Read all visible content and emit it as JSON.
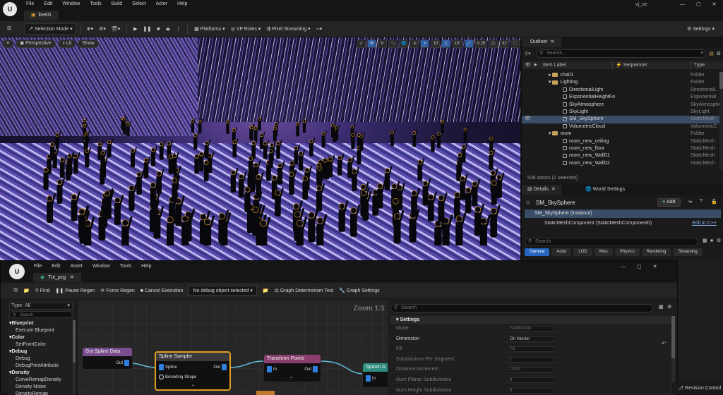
{
  "window": {
    "menu": [
      "File",
      "Edit",
      "Window",
      "Tools",
      "Build",
      "Select",
      "Actor",
      "Help"
    ],
    "tab": "live01",
    "user": "vj_ue",
    "controls": [
      "—",
      "▢",
      "✕"
    ]
  },
  "toolbar": {
    "mode": "Selection Mode",
    "platforms": "Platforms",
    "vp_roles": "VP Roles",
    "pixel_streaming": "Pixel Streaming",
    "settings": "Settings"
  },
  "viewport": {
    "perspective": "Perspective",
    "lit": "Lit",
    "show": "Show",
    "grid_snap": "10",
    "rot_snap": "10°",
    "scale_snap": "0.25",
    "cam_speed": "32"
  },
  "outliner": {
    "title": "Outliner",
    "search_placeholder": "Search...",
    "col_label": "Item Label",
    "col_sequencer": "Sequencer",
    "col_type": "Type",
    "rows": [
      {
        "label": "cha01",
        "type": "Folder",
        "kind": "folder",
        "depth": 1
      },
      {
        "label": "Lighting",
        "type": "Folder",
        "kind": "folder",
        "depth": 1
      },
      {
        "label": "DirectionalLight",
        "type": "DirectionalL",
        "kind": "actor",
        "depth": 2
      },
      {
        "label": "ExponentialHeightFo",
        "type": "Exponential",
        "kind": "actor",
        "depth": 2
      },
      {
        "label": "SkyAtmosphere",
        "type": "SkyAtmosphe",
        "kind": "actor",
        "depth": 2
      },
      {
        "label": "SkyLight",
        "type": "SkyLight",
        "kind": "actor",
        "depth": 2
      },
      {
        "label": "SM_SkySphere",
        "type": "StaticMesh",
        "kind": "actor",
        "depth": 2,
        "selected": true
      },
      {
        "label": "VolumetricCloud",
        "type": "VolumetricC",
        "kind": "actor",
        "depth": 2
      },
      {
        "label": "room",
        "type": "Folder",
        "kind": "folder",
        "depth": 1
      },
      {
        "label": "room_new_ceiling",
        "type": "StaticMesh",
        "kind": "actor",
        "depth": 2
      },
      {
        "label": "room_new_floor",
        "type": "StaticMesh",
        "kind": "actor",
        "depth": 2
      },
      {
        "label": "room_new_Wall01",
        "type": "StaticMesh",
        "kind": "actor",
        "depth": 2
      },
      {
        "label": "room_new_Wall02",
        "type": "StaticMesh",
        "kind": "actor",
        "depth": 2
      }
    ],
    "status": "538 actors (1 selected)"
  },
  "details": {
    "tab": "Details",
    "tab2": "World Settings",
    "selected": "SM_SkySphere",
    "add": "Add",
    "instance": "SM_SkySphere (Instance)",
    "component": "StaticMeshComponent (StaticMeshComponent0)",
    "edit_cpp": "Edit in C++",
    "search_placeholder": "Search",
    "categories": [
      "General",
      "Actor",
      "LOD",
      "Misc",
      "Physics",
      "Rendering",
      "Streaming"
    ]
  },
  "pcg": {
    "menu": [
      "File",
      "Edit",
      "Asset",
      "Window",
      "Tools",
      "Help"
    ],
    "tab": "Tut_pcg",
    "toolbar": {
      "find": "Find",
      "pause": "Pause Regen",
      "force": "Force Regen",
      "cancel": "Cancel Execution",
      "debug_object": "No debug object selected",
      "determinism": "Graph Determinism Test",
      "graph_settings": "Graph Settings"
    },
    "palette": {
      "type_label": "Type:",
      "type_value": "All",
      "search_placeholder": "Search",
      "items": [
        {
          "text": "Blueprint",
          "cat": true
        },
        {
          "text": "Execute Blueprint",
          "cat": false
        },
        {
          "text": "Color",
          "cat": true
        },
        {
          "text": "SetPointColor",
          "cat": false
        },
        {
          "text": "Debug",
          "cat": true
        },
        {
          "text": "Debug",
          "cat": false
        },
        {
          "text": "DebugPrintAttribute",
          "cat": false
        },
        {
          "text": "Density",
          "cat": true
        },
        {
          "text": "CurveRemapDensity",
          "cat": false
        },
        {
          "text": "Density Noise",
          "cat": false
        },
        {
          "text": "DensityRemap",
          "cat": false
        }
      ]
    },
    "graph": {
      "zoom": "Zoom 1:1",
      "nodes": {
        "get_spline": {
          "title": "Get Spline Data",
          "out": "Out",
          "color": "#7a4e8e"
        },
        "sampler": {
          "title": "Spline Sampler",
          "in1": "Spline",
          "in2": "Bounding Shape",
          "out": "Out",
          "color": "#4e4e4e"
        },
        "transform": {
          "title": "Transform Points",
          "in": "In",
          "out": "Out",
          "color": "#8a3e6e"
        },
        "spawn": {
          "title": "Spawn A",
          "in": "In",
          "color": "#2e8e7e"
        }
      }
    },
    "settings": {
      "search_placeholder": "Search",
      "section": "Settings",
      "rows": [
        {
          "key": "Mode",
          "value": "Subdivision",
          "active": false
        },
        {
          "key": "Dimension",
          "value": "On Interior",
          "active": true
        },
        {
          "key": "Fill",
          "value": "Fill",
          "active": false
        },
        {
          "key": "Subdivisions Per Segment",
          "value": "1",
          "active": false
        },
        {
          "key": "Distance Increment",
          "value": "100.0",
          "active": false
        },
        {
          "key": "Num Planar Subdivisions",
          "value": "8",
          "active": false
        },
        {
          "key": "Num Height Subdivisions",
          "value": "8",
          "active": false
        }
      ]
    }
  },
  "footer": {
    "revision": "Revision Control"
  },
  "colors": {
    "accent": "#2766c0",
    "selection": "#3a4d67",
    "play": "#52c24a"
  }
}
